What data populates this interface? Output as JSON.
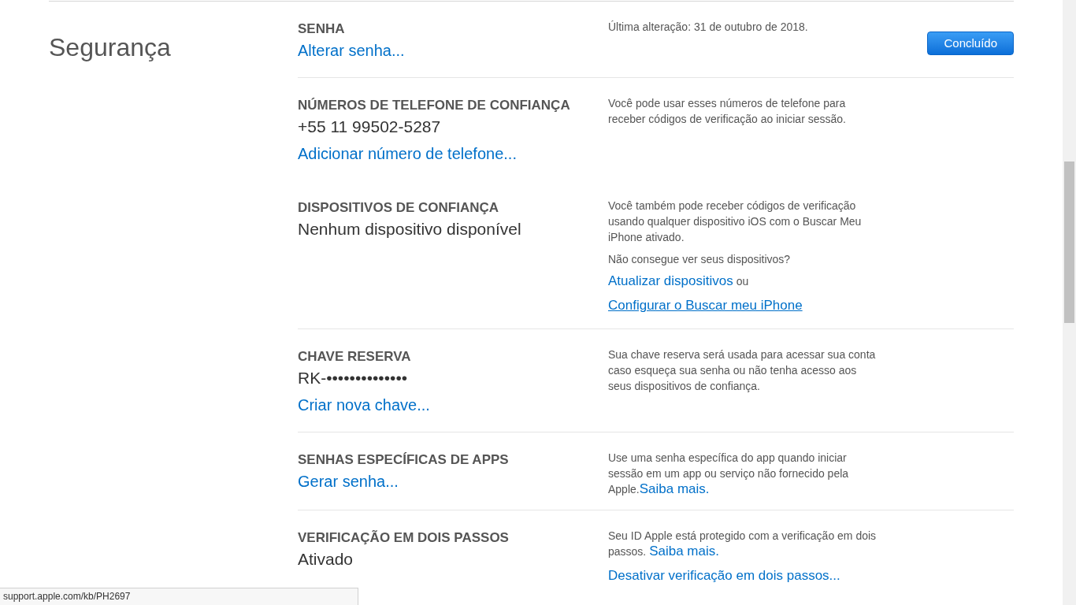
{
  "section_title": "Segurança",
  "done_button": "Concluído",
  "groups": [
    {
      "rows": [
        {
          "label": "SENHA",
          "values": [],
          "links": [
            "Alterar senha..."
          ],
          "description": [
            [
              {
                "kind": "text",
                "text": "Última alteração: 31 de outubro de 2018."
              }
            ]
          ]
        }
      ]
    },
    {
      "rows": [
        {
          "label": "NÚMEROS DE TELEFONE DE CONFIANÇA",
          "values": [
            "+55 11 99502-5287"
          ],
          "links": [
            "Adicionar número de telefone..."
          ],
          "description": [
            [
              {
                "kind": "text",
                "text": "Você pode usar esses números de telefone para receber códigos de verificação ao iniciar sessão."
              }
            ]
          ]
        },
        {
          "label": "DISPOSITIVOS DE CONFIANÇA",
          "values": [
            "Nenhum dispositivo disponível"
          ],
          "links": [],
          "description": [
            [
              {
                "kind": "text",
                "text": "Você também pode receber códigos de verificação usando qualquer dispositivo iOS com o Buscar Meu iPhone ativado."
              }
            ],
            [
              {
                "kind": "text",
                "text": "Não consegue ver seus dispositivos?"
              }
            ],
            [
              {
                "kind": "link",
                "text": "Atualizar dispositivos",
                "underlined": false
              },
              {
                "kind": "text",
                "text": " ou"
              }
            ],
            [
              {
                "kind": "link",
                "text": "Configurar o Buscar meu iPhone",
                "underlined": true
              }
            ]
          ]
        }
      ]
    },
    {
      "rows": [
        {
          "label": "CHAVE RESERVA",
          "values": [
            "RK-••••••••••••••"
          ],
          "links": [
            "Criar nova chave..."
          ],
          "description": [
            [
              {
                "kind": "text",
                "text": "Sua chave reserva será usada para acessar sua conta caso esqueça sua senha ou não tenha acesso aos seus dispositivos de confiança."
              }
            ]
          ]
        }
      ]
    },
    {
      "rows": [
        {
          "label": "SENHAS ESPECÍFICAS DE APPS",
          "values": [],
          "links": [
            "Gerar senha..."
          ],
          "description": [
            [
              {
                "kind": "text",
                "text": "Use uma senha específica do app quando iniciar sessão em um app ou serviço não fornecido pela Apple."
              },
              {
                "kind": "link",
                "text": "Saiba mais.",
                "underlined": false
              }
            ]
          ]
        }
      ]
    },
    {
      "rows": [
        {
          "label": "VERIFICAÇÃO EM DOIS PASSOS",
          "values": [
            "Ativado"
          ],
          "links": [],
          "description": [
            [
              {
                "kind": "text",
                "text": "Seu ID Apple está protegido com a verificação em dois passos. "
              },
              {
                "kind": "link",
                "text": "Saiba mais.",
                "underlined": false
              }
            ],
            [
              {
                "kind": "link",
                "text": "Desativar verificação em dois passos...",
                "underlined": false
              }
            ]
          ]
        }
      ]
    }
  ],
  "status_bar": "support.apple.com/kb/PH2697"
}
